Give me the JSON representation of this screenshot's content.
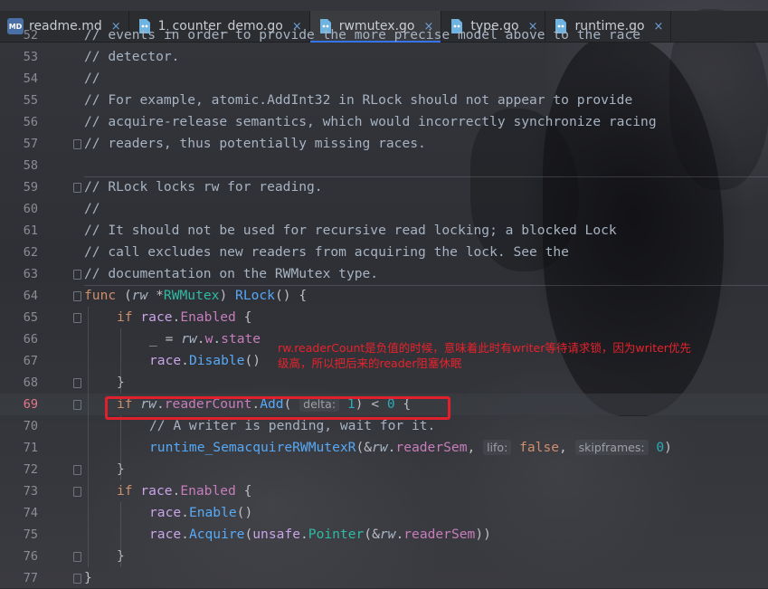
{
  "tabs": [
    {
      "label": "readme.md",
      "icon": "markdown-icon",
      "icon_text": "MD",
      "active": false
    },
    {
      "label": "1_counter_demo.go",
      "icon": "go-file-icon",
      "active": false
    },
    {
      "label": "rwmutex.go",
      "icon": "go-file-icon",
      "active": true
    },
    {
      "label": "type.go",
      "icon": "go-file-icon",
      "active": false
    },
    {
      "label": "runtime.go",
      "icon": "go-file-icon",
      "active": false
    }
  ],
  "tab_close_glyph": "×",
  "editor": {
    "current_line": 69,
    "lines": [
      {
        "n": "52",
        "text": "// events in order to provide the more precise model above to the race"
      },
      {
        "n": "53",
        "text": "// detector."
      },
      {
        "n": "54",
        "text": "//"
      },
      {
        "n": "55",
        "text": "// For example, atomic.AddInt32 in RLock should not appear to provide"
      },
      {
        "n": "56",
        "text": "// acquire-release semantics, which would incorrectly synchronize racing"
      },
      {
        "n": "57",
        "text": "// readers, thus potentially missing races."
      },
      {
        "n": "58",
        "text": ""
      },
      {
        "n": "59",
        "text": "// RLock locks rw for reading."
      },
      {
        "n": "60",
        "text": "//"
      },
      {
        "n": "61",
        "text": "// It should not be used for recursive read locking; a blocked Lock"
      },
      {
        "n": "62",
        "text": "// call excludes new readers from acquiring the lock. See the"
      },
      {
        "n": "63",
        "text": "// documentation on the RWMutex type."
      },
      {
        "n": "64",
        "text": "func (rw *RWMutex) RLock() {"
      },
      {
        "n": "65",
        "text": "if race.Enabled {"
      },
      {
        "n": "66",
        "text": "_ = rw.w.state"
      },
      {
        "n": "67",
        "text": "race.Disable()"
      },
      {
        "n": "68",
        "text": "}"
      },
      {
        "n": "69",
        "text": "if rw.readerCount.Add( delta: 1) < 0 {"
      },
      {
        "n": "70",
        "text": "// A writer is pending, wait for it."
      },
      {
        "n": "71",
        "text": "runtime_SemacquireRWMutexR(&rw.readerSem,  lifo: false,  skipframes: 0)"
      },
      {
        "n": "72",
        "text": "}"
      },
      {
        "n": "73",
        "text": "if race.Enabled {"
      },
      {
        "n": "74",
        "text": "race.Enable()"
      },
      {
        "n": "75",
        "text": "race.Acquire(unsafe.Pointer(&rw.readerSem))"
      },
      {
        "n": "76",
        "text": "}"
      },
      {
        "n": "77",
        "text": "}"
      }
    ],
    "param_hints": {
      "delta": "delta:",
      "lifo": "lifo:",
      "skipframes": "skipframes:"
    }
  },
  "annotation": {
    "line1": "rw.readerCount是负值的时候，意味着此时有writer等待请求锁，因为writer优先",
    "line2": "级高，所以把后来的reader阻塞休眠"
  },
  "colors": {
    "annotation": "#e8222c",
    "highlight_box": "#e0202c",
    "active_line_number": "#e8778a"
  }
}
